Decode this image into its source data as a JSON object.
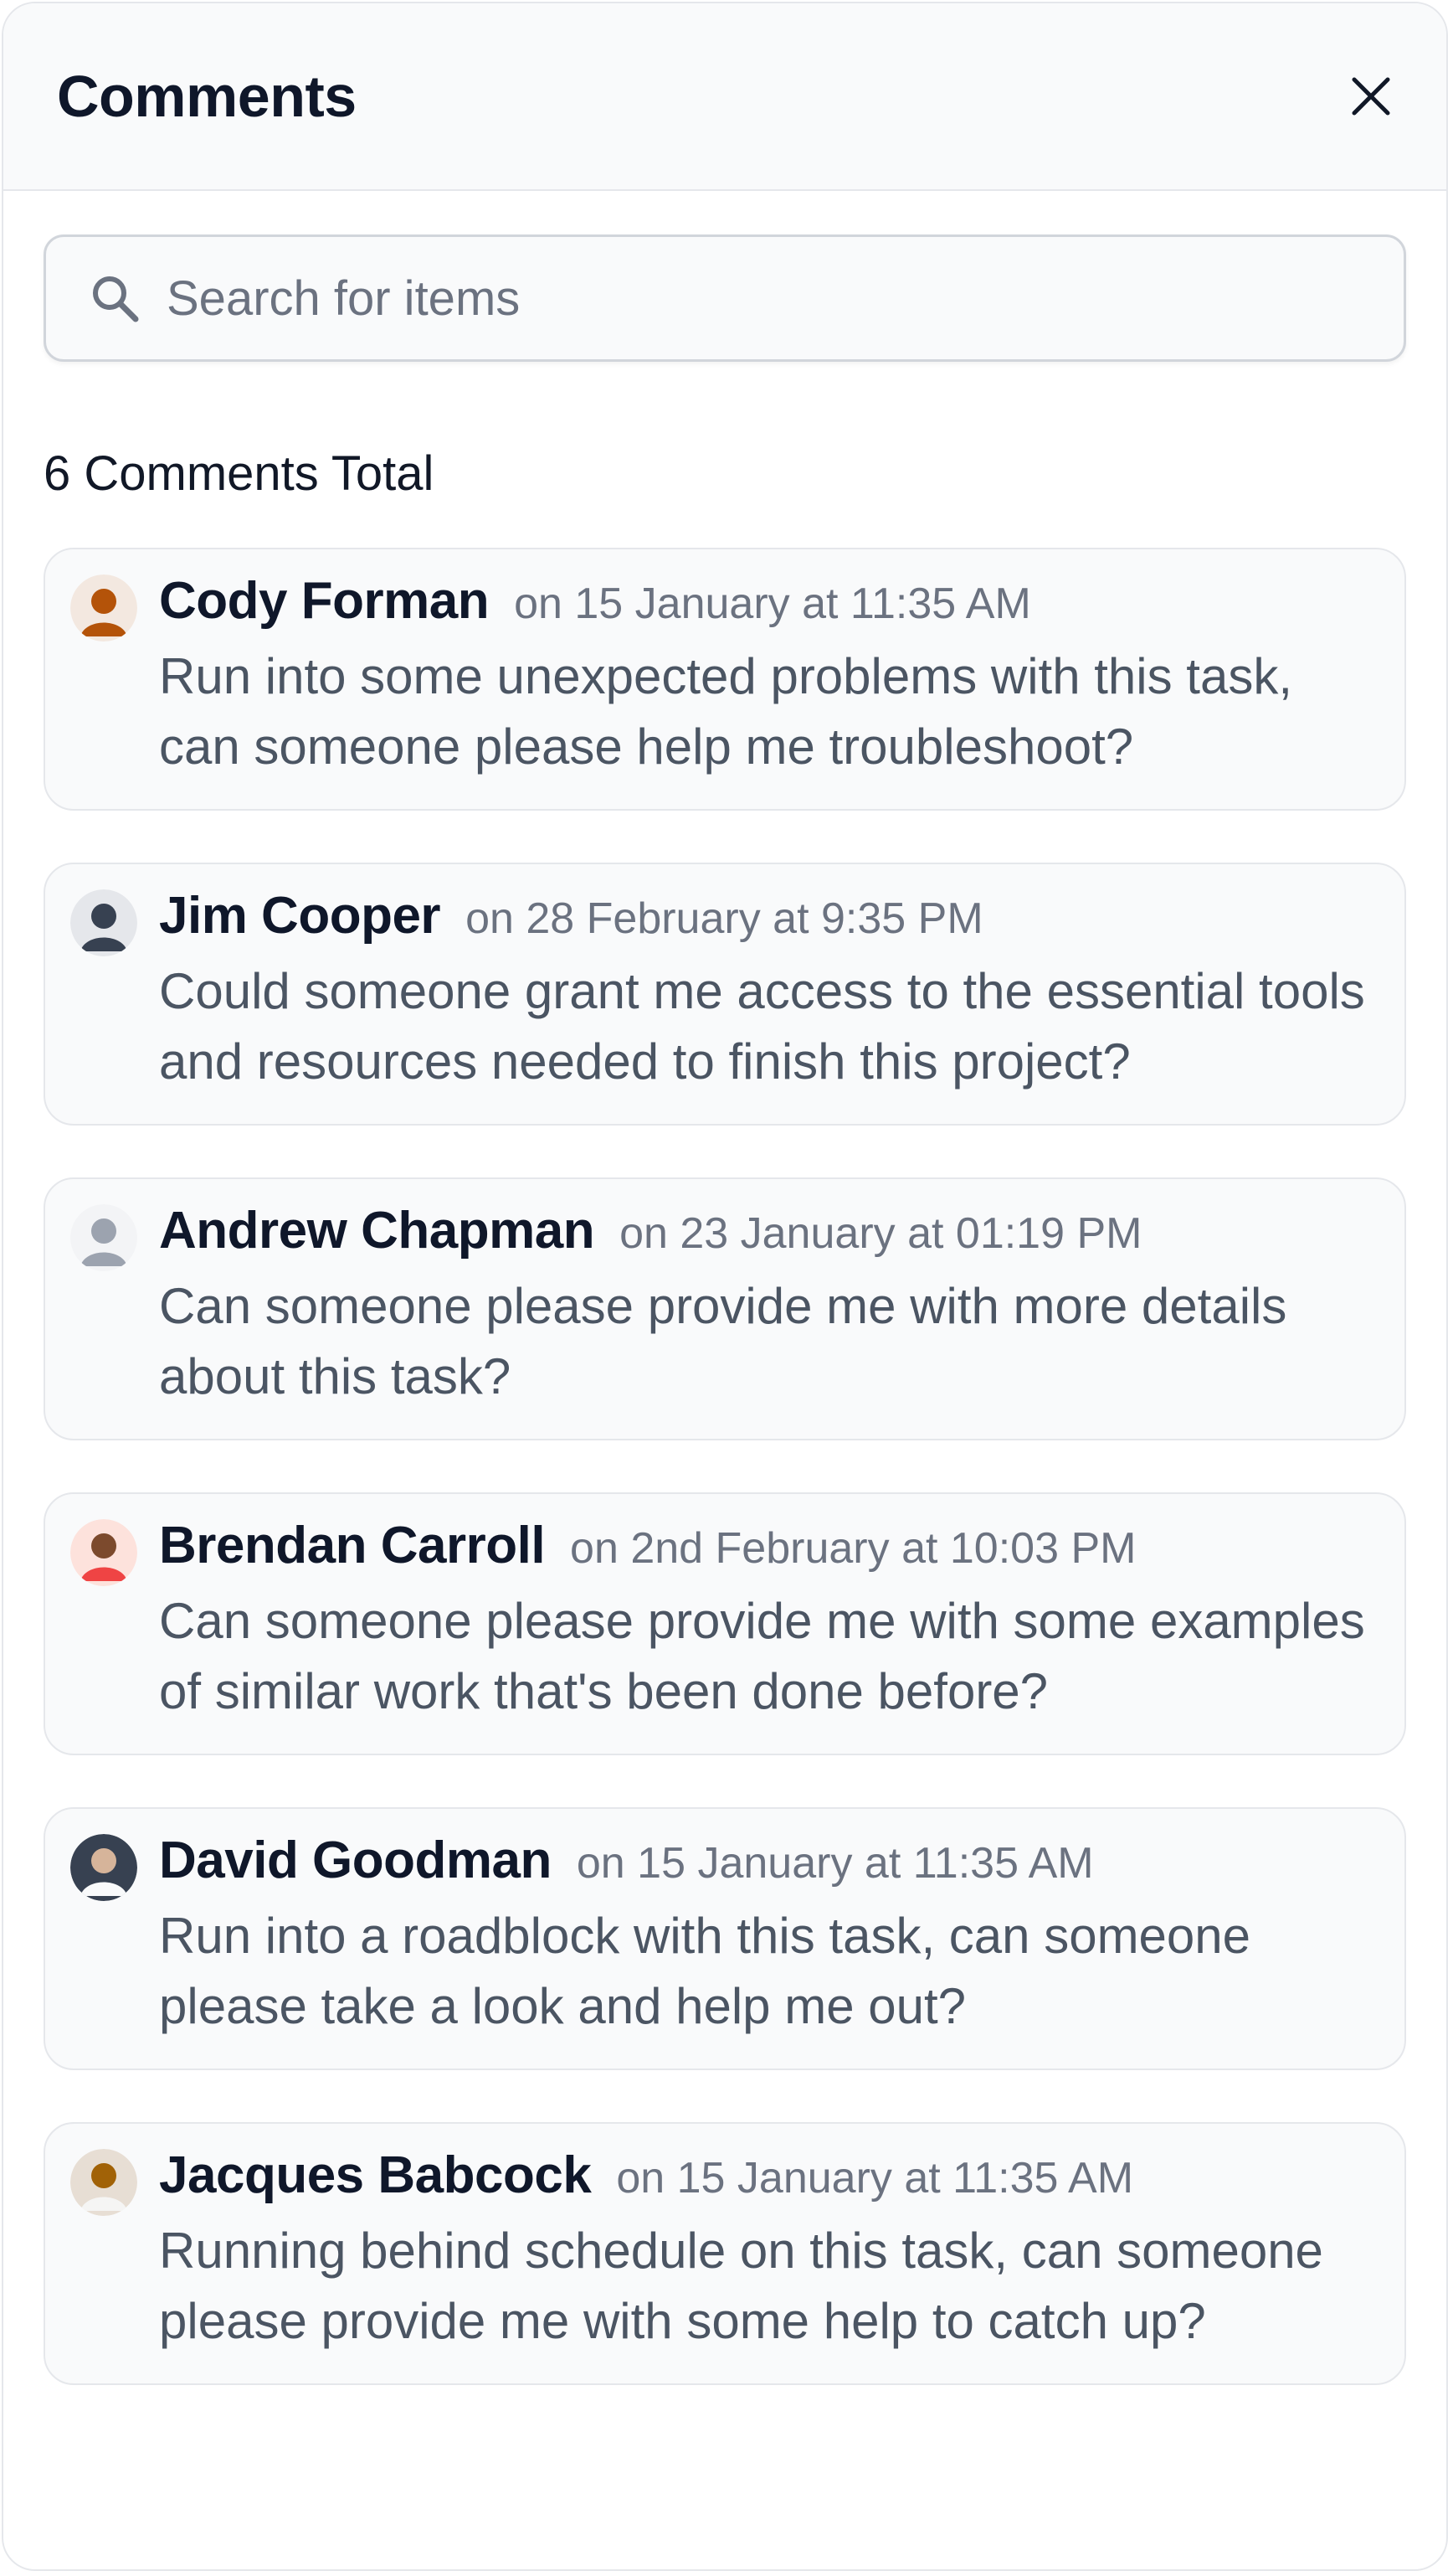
{
  "header": {
    "title": "Comments"
  },
  "search": {
    "placeholder": "Search for items",
    "value": ""
  },
  "summary": {
    "total_label": "6 Comments Total"
  },
  "comments": [
    {
      "author": "Cody Forman",
      "time": "on 15 January at 11:35 AM",
      "text": "Run into some unexpected problems with this task, can someone please help me troubleshoot?",
      "avatar_color": "#b45309"
    },
    {
      "author": "Jim Cooper",
      "time": "on 28 February at 9:35 PM",
      "text": "Could someone grant me access to the essential tools and resources needed to finish this project?",
      "avatar_color": "#374151"
    },
    {
      "author": "Andrew Chapman",
      "time": "on 23 January at 01:19 PM",
      "text": "Can someone please provide me with more details about this task?",
      "avatar_color": "#9ca3af"
    },
    {
      "author": "Brendan Carroll",
      "time": "on 2nd February at 10:03 PM",
      "text": "Can someone please provide me with some examples of similar work that's been done before?",
      "avatar_color": "#ef4444"
    },
    {
      "author": "David Goodman",
      "time": "on 15 January at 11:35 AM",
      "text": "Run into a roadblock with this task, can someone please take a look and help me out?",
      "avatar_color": "#1f2937"
    },
    {
      "author": "Jacques Babcock",
      "time": "on 15 January at 11:35 AM",
      "text": "Running behind schedule on this task, can someone please provide me with some help to catch up?",
      "avatar_color": "#a16207"
    }
  ]
}
